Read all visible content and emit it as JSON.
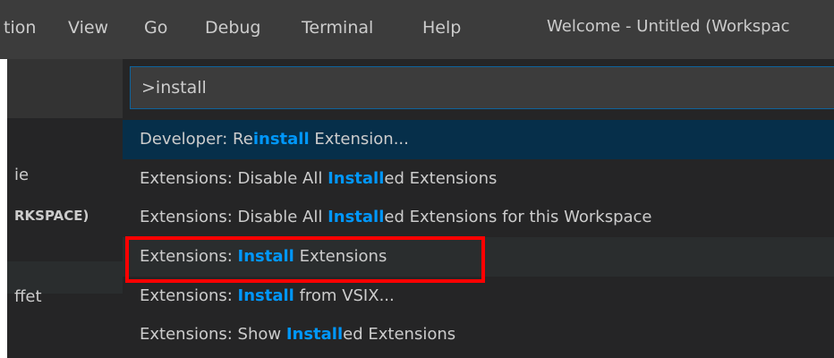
{
  "menubar": {
    "items": [
      "tion",
      "View",
      "Go",
      "Debug",
      "Terminal",
      "Help"
    ],
    "window_title": "Welcome - Untitled (Workspac"
  },
  "sidebar": {
    "items": [
      "ie",
      "RKSPACE)",
      "ffet"
    ]
  },
  "command_palette": {
    "input_value": ">install",
    "results": [
      {
        "pre": "Developer: Re",
        "hl": "install",
        "post": " Extension..."
      },
      {
        "pre": "Extensions: Disable All ",
        "hl": "Install",
        "post": "ed Extensions"
      },
      {
        "pre": "Extensions: Disable All ",
        "hl": "Install",
        "post": "ed Extensions for this Workspace"
      },
      {
        "pre": "Extensions: ",
        "hl": "Install",
        "post": " Extensions"
      },
      {
        "pre": "Extensions: ",
        "hl": "Install",
        "post": " from VSIX..."
      },
      {
        "pre": "Extensions: Show ",
        "hl": "Install",
        "post": "ed Extensions"
      }
    ]
  },
  "colors": {
    "highlight_text": "#0097fb",
    "annotation_box": "#ff0000",
    "selected_row": "#062f4a"
  }
}
